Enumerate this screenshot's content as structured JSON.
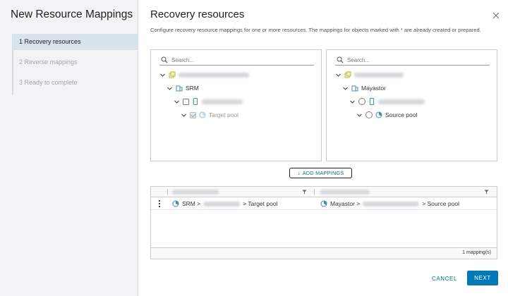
{
  "wizard": {
    "title": "New Resource Mappings",
    "steps": [
      {
        "label": "1  Recovery resources",
        "state": "active"
      },
      {
        "label": "2  Reverse mappings",
        "state": "disabled"
      },
      {
        "label": "3  Ready to complete",
        "state": "disabled"
      }
    ]
  },
  "page": {
    "title": "Recovery resources",
    "description": "Configure recovery resource mappings for one or more resources. The mappings for objects marked with * are already created or prepared."
  },
  "left_tree": {
    "search_placeholder": "Search...",
    "site_label": "SRM",
    "leaf_label": "Target pool"
  },
  "right_tree": {
    "search_placeholder": "Search...",
    "site_label": "Mayastor",
    "leaf_label": "Source pool"
  },
  "add_mappings_label": "ADD MAPPINGS",
  "grid": {
    "rows": [
      {
        "left_prefix": "SRM >",
        "left_suffix": "> Target pool",
        "right_prefix": "Mayastor >",
        "right_suffix": "> Source pool"
      }
    ],
    "footer": "1 mapping(s)"
  },
  "buttons": {
    "cancel": "CANCEL",
    "next": "NEXT"
  },
  "colors": {
    "accent": "#0079b8",
    "link": "#0072a3",
    "active_step_bg": "#d8e3eb",
    "datacenter_icon": "#c1c73a",
    "host_icon": "#4a87c9"
  }
}
